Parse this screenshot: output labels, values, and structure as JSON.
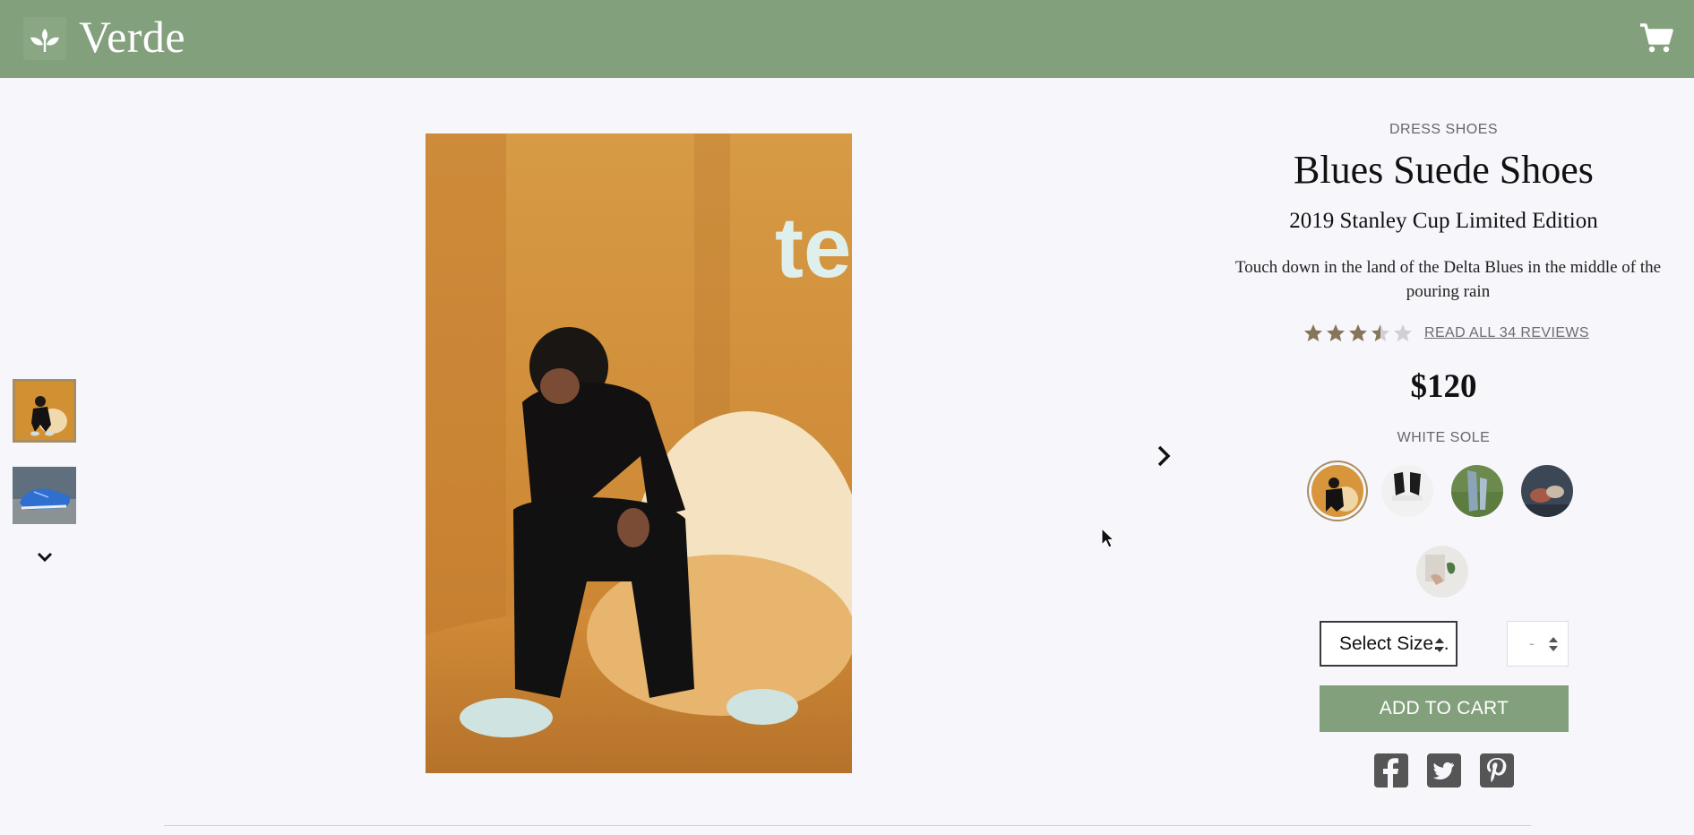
{
  "brand": {
    "name": "Verde"
  },
  "header": {
    "cart_icon": "shopping-cart-icon"
  },
  "gallery": {
    "thumbnails": [
      {
        "name": "thumbnail-1",
        "selected": true
      },
      {
        "name": "thumbnail-2",
        "selected": false
      }
    ],
    "more_icon": "chevron-down-icon",
    "next_icon": "chevron-right-icon"
  },
  "product": {
    "category": "DRESS SHOES",
    "title": "Blues Suede Shoes",
    "subtitle": "2019 Stanley Cup Limited Edition",
    "description": "Touch down in the land of the Delta Blues in the middle of the pouring rain",
    "rating": {
      "value": 3.5,
      "max": 5,
      "reviews_label": "READ ALL 34 REVIEWS"
    },
    "price": "$120",
    "variant_label": "WHITE SOLE",
    "variants": [
      {
        "name": "swatch-1",
        "selected": true
      },
      {
        "name": "swatch-2",
        "selected": false
      },
      {
        "name": "swatch-3",
        "selected": false
      },
      {
        "name": "swatch-4",
        "selected": false
      },
      {
        "name": "swatch-5",
        "selected": false
      }
    ],
    "size_select": {
      "value": "Select Size..."
    },
    "quantity_select": {
      "value": "-"
    },
    "add_to_cart_label": "ADD TO CART"
  },
  "share": {
    "icons": [
      "facebook-icon",
      "twitter-icon",
      "pinterest-icon"
    ]
  },
  "colors": {
    "brand_green": "#83a07d",
    "accent_gold": "#a88d62",
    "background": "#f6f6fb"
  }
}
